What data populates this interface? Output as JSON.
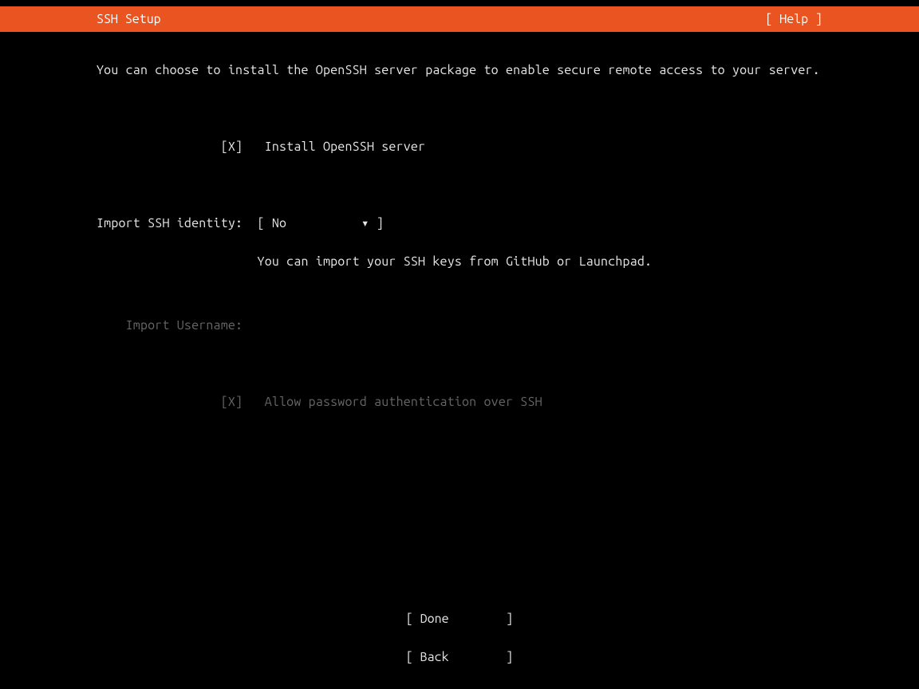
{
  "header": {
    "title": "SSH Setup",
    "help": "[ Help ]"
  },
  "intro": "You can choose to install the OpenSSH server package to enable secure remote access to your server.",
  "install": {
    "mark": "[X]",
    "label": "Install OpenSSH server"
  },
  "import_identity": {
    "label": "Import SSH identity:",
    "open": "[",
    "value": "No",
    "arrow": "▾",
    "close": "]",
    "helper": "You can import your SSH keys from GitHub or Launchpad."
  },
  "import_username": {
    "label": "Import Username:",
    "value": ""
  },
  "allow_password": {
    "mark": "[X]",
    "label": "Allow password authentication over SSH"
  },
  "footer": {
    "done": "[ Done        ]",
    "back": "[ Back        ]"
  }
}
